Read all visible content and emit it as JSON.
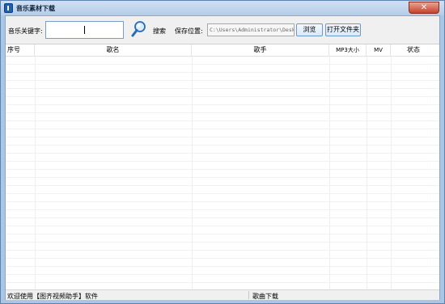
{
  "window": {
    "title": "音乐素材下载",
    "close_label": "✕"
  },
  "toolbar": {
    "keyword_label": "音乐关键字:",
    "keyword_value": "",
    "search_label": "搜索",
    "save_location_label": "保存位置:",
    "save_path": "C:\\Users\\Administrator\\Deskto",
    "browse_label": "浏览",
    "open_folder_label": "打开文件夹"
  },
  "table": {
    "columns": [
      "序号",
      "歌名",
      "歌手",
      "MP3大小",
      "MV",
      "状态"
    ],
    "rows": []
  },
  "status": {
    "left_text": "欢迎使用【图齐视频助手】软件",
    "right_text": "歌曲下载"
  }
}
